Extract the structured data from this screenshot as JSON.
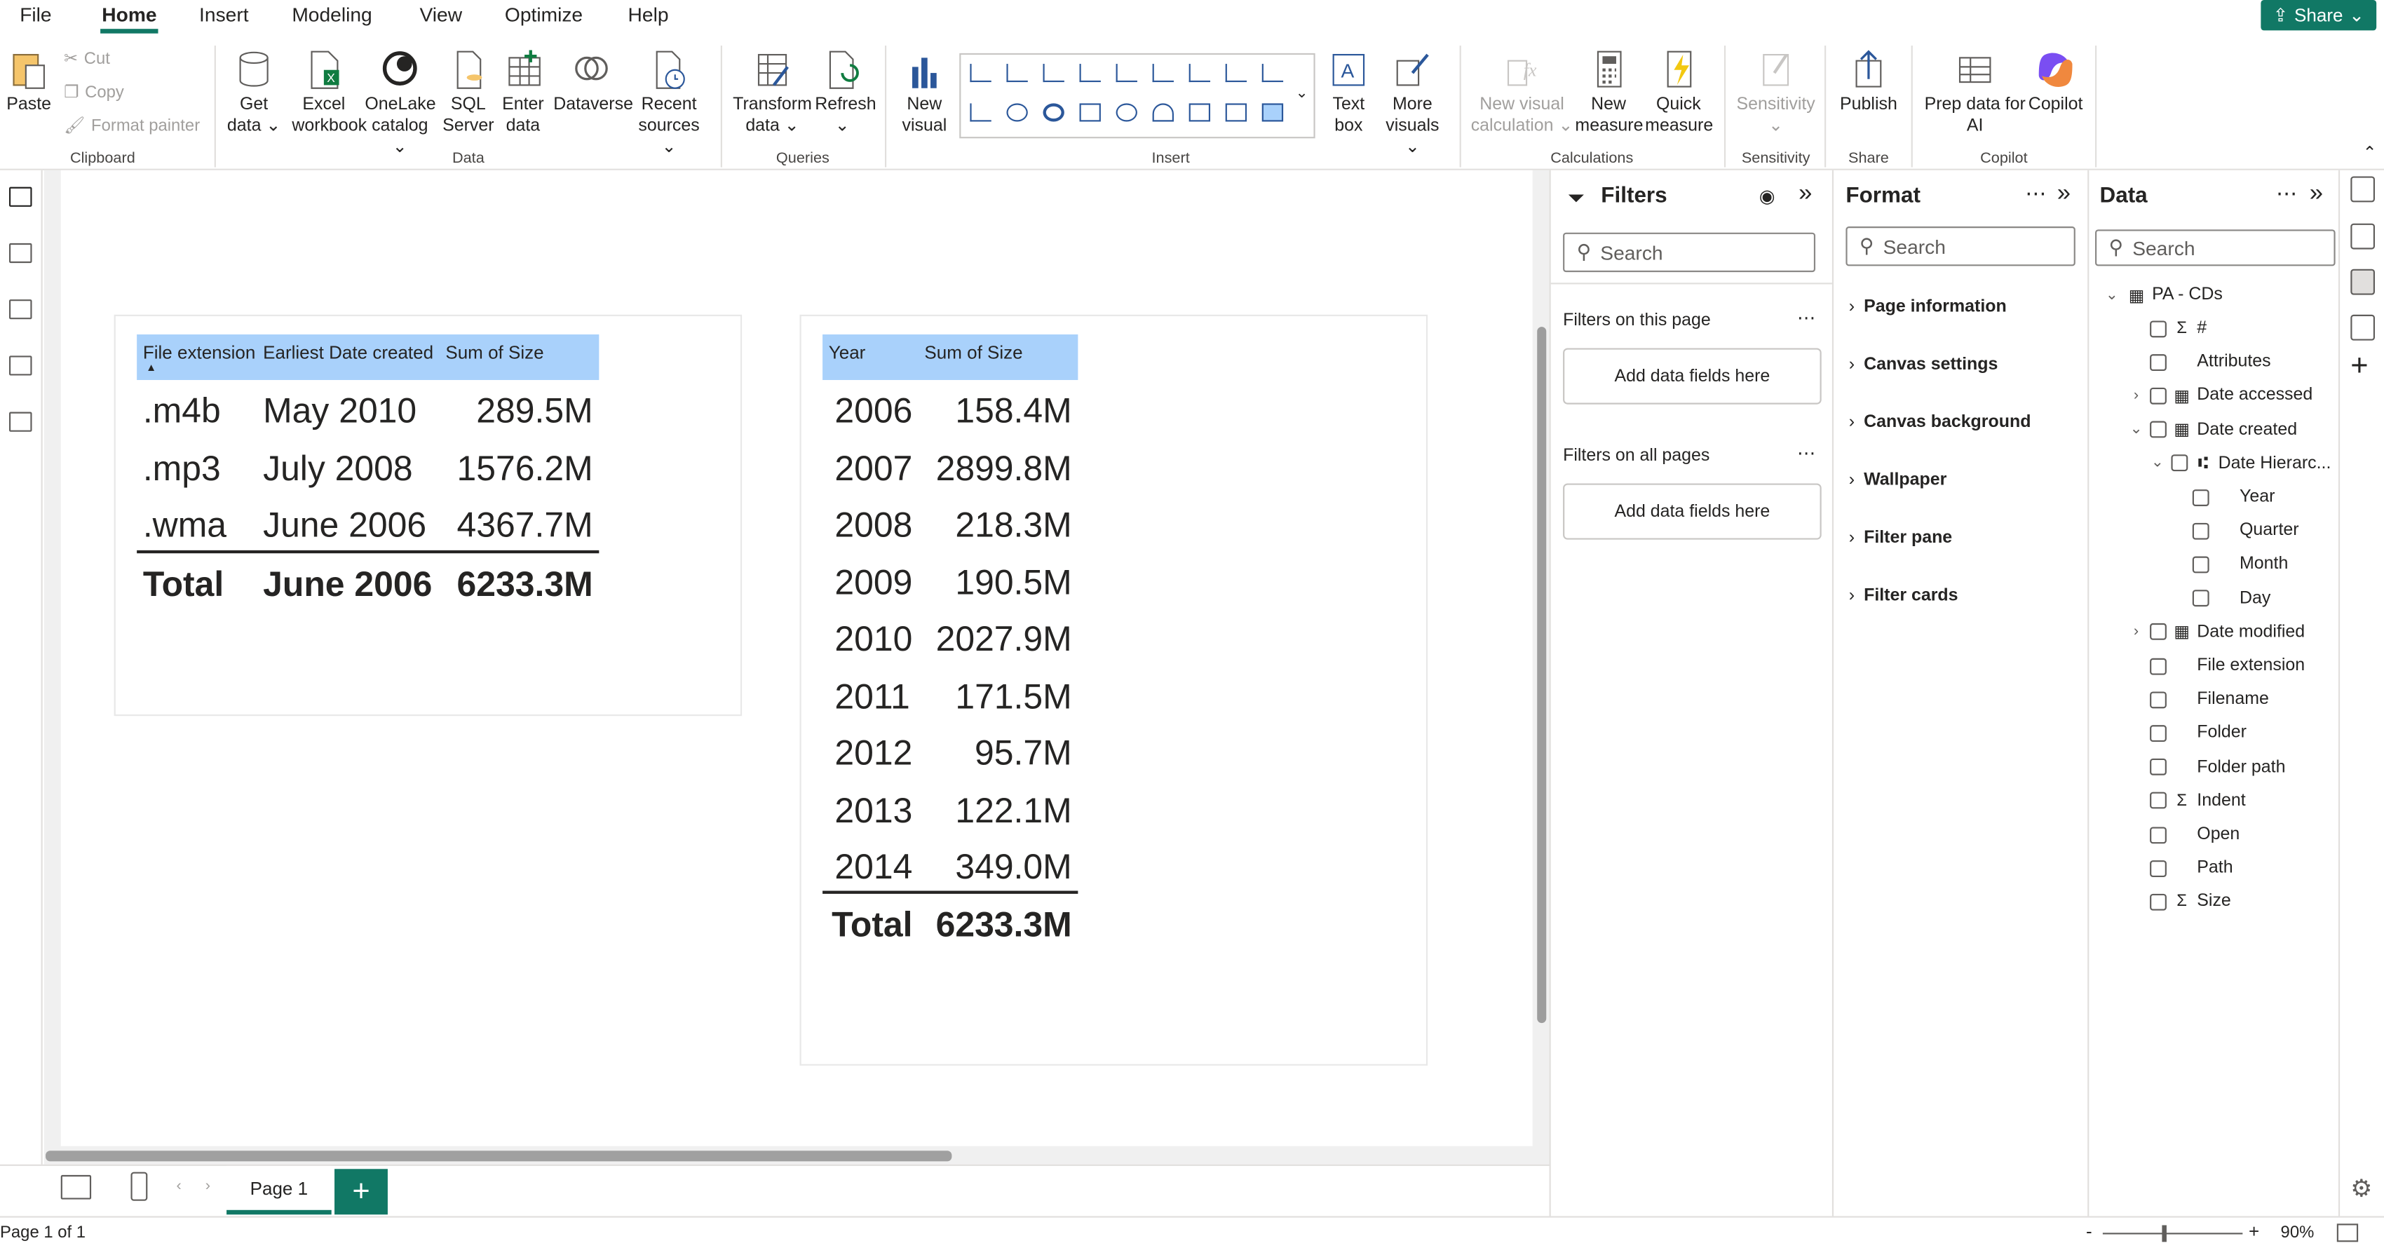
{
  "menu": {
    "file": "File",
    "home": "Home",
    "insert": "Insert",
    "modeling": "Modeling",
    "view": "View",
    "optimize": "Optimize",
    "help": "Help",
    "share": "Share"
  },
  "ribbon": {
    "paste": "Paste",
    "cut": "Cut",
    "copy": "Copy",
    "format_painter": "Format painter",
    "clipboard": "Clipboard",
    "get_data_1": "Get",
    "get_data_2": "data",
    "excel_1": "Excel",
    "excel_2": "workbook",
    "onelake_1": "OneLake",
    "onelake_2": "catalog",
    "sql_1": "SQL",
    "sql_2": "Server",
    "enter_1": "Enter",
    "enter_2": "data",
    "dataverse": "Dataverse",
    "recent_1": "Recent",
    "recent_2": "sources",
    "data": "Data",
    "transform_1": "Transform",
    "transform_2": "data",
    "refresh": "Refresh",
    "queries": "Queries",
    "new_visual_1": "New",
    "new_visual_2": "visual",
    "text_box_1": "Text",
    "text_box_2": "box",
    "more_visuals_1": "More",
    "more_visuals_2": "visuals",
    "insert": "Insert",
    "new_visual_calc_1": "New visual",
    "new_visual_calc_2": "calculation",
    "new_measure_1": "New",
    "new_measure_2": "measure",
    "quick_measure_1": "Quick",
    "quick_measure_2": "measure",
    "calculations": "Calculations",
    "sensitivity": "Sensitivity",
    "sensitivity_group": "Sensitivity",
    "publish": "Publish",
    "share": "Share",
    "prep_data_1": "Prep data for",
    "prep_data_2": "AI",
    "copilot": "Copilot",
    "copilot_group": "Copilot"
  },
  "table1": {
    "headers": [
      "File extension",
      "Earliest Date created",
      "Sum of Size"
    ],
    "rows": [
      [
        ".m4b",
        "May 2010",
        "289.5M"
      ],
      [
        ".mp3",
        "July 2008",
        "1576.2M"
      ],
      [
        ".wma",
        "June 2006",
        "4367.7M"
      ]
    ],
    "total": [
      "Total",
      "June 2006",
      "6233.3M"
    ]
  },
  "table2": {
    "headers": [
      "Year",
      "Sum of Size"
    ],
    "rows": [
      [
        "2006",
        "158.4M"
      ],
      [
        "2007",
        "2899.8M"
      ],
      [
        "2008",
        "218.3M"
      ],
      [
        "2009",
        "190.5M"
      ],
      [
        "2010",
        "2027.9M"
      ],
      [
        "2011",
        "171.5M"
      ],
      [
        "2012",
        "95.7M"
      ],
      [
        "2013",
        "122.1M"
      ],
      [
        "2014",
        "349.0M"
      ]
    ],
    "total": [
      "Total",
      "6233.3M"
    ]
  },
  "filters": {
    "title": "Filters",
    "search": "Search",
    "on_page": "Filters on this page",
    "on_all": "Filters on all pages",
    "add_fields": "Add data fields here"
  },
  "format": {
    "title": "Format",
    "search": "Search",
    "items": [
      "Page information",
      "Canvas settings",
      "Canvas background",
      "Wallpaper",
      "Filter pane",
      "Filter cards"
    ]
  },
  "data": {
    "title": "Data",
    "search": "Search",
    "table": "PA - CDs",
    "fields": [
      "#",
      "Attributes",
      "Date accessed",
      "Date created",
      "Date Hierarc...",
      "Year",
      "Quarter",
      "Month",
      "Day",
      "Date modified",
      "File extension",
      "Filename",
      "Folder",
      "Folder path",
      "Indent",
      "Open",
      "Path",
      "Size"
    ]
  },
  "pages": {
    "page1": "Page 1"
  },
  "status": {
    "page_info": "Page 1 of 1",
    "zoom": "90%"
  }
}
